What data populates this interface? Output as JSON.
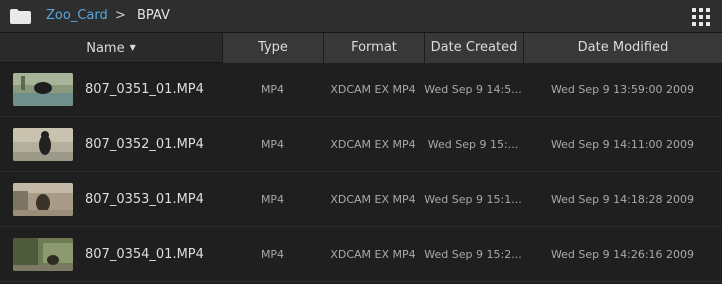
{
  "breadcrumb": {
    "parent": "Zoo_Card",
    "separator": ">",
    "current": "BPAV"
  },
  "columns": {
    "name": "Name",
    "type": "Type",
    "format": "Format",
    "created": "Date Created",
    "modified": "Date Modified"
  },
  "rows": [
    {
      "name": "807_0351_01.MP4",
      "type": "MP4",
      "format": "XDCAM EX MP4",
      "created": "Wed Sep  9 14:5...",
      "modified": "Wed Sep  9 13:59:00 2009"
    },
    {
      "name": "807_0352_01.MP4",
      "type": "MP4",
      "format": "XDCAM EX MP4",
      "created": "Wed Sep  9 15:...",
      "modified": "Wed Sep  9 14:11:00 2009"
    },
    {
      "name": "807_0353_01.MP4",
      "type": "MP4",
      "format": "XDCAM EX MP4",
      "created": "Wed Sep  9 15:1...",
      "modified": "Wed Sep  9 14:18:28 2009"
    },
    {
      "name": "807_0354_01.MP4",
      "type": "MP4",
      "format": "XDCAM EX MP4",
      "created": "Wed Sep  9 15:2...",
      "modified": "Wed Sep  9 14:26:16 2009"
    }
  ],
  "colors": {
    "link": "#56a8e0",
    "background": "#1f1f1f",
    "header": "#2a2a2a"
  },
  "icons": {
    "folder": "folder-icon",
    "sort": "sort-desc-icon",
    "view": "grid-view-icon"
  }
}
